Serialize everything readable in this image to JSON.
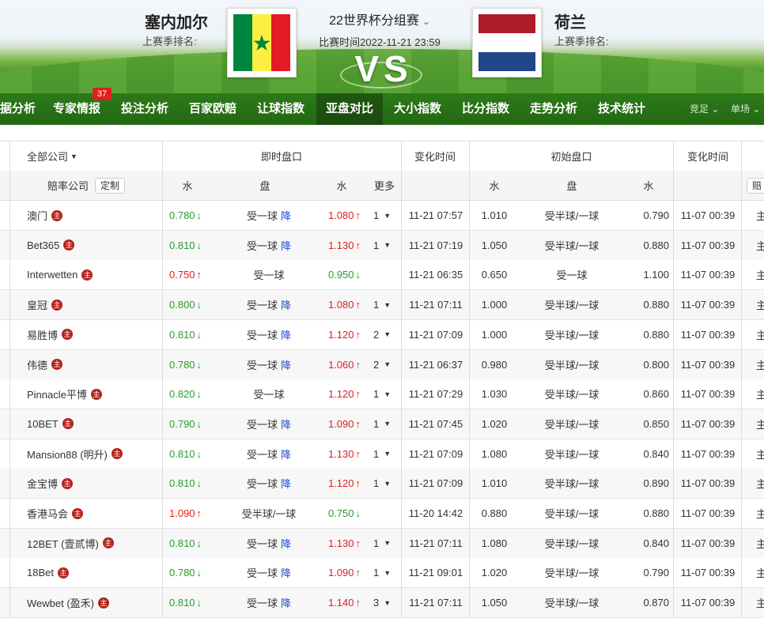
{
  "header": {
    "home_team": "塞内加尔",
    "home_rank_label": "上赛季排名:",
    "away_team": "荷兰",
    "away_rank_label": "上赛季排名:",
    "league": "22世界杯分组赛",
    "match_time": "比赛时间2022-11-21 23:59",
    "vs": "VS"
  },
  "colors": {
    "senegal": [
      "#00853f",
      "#fdef42",
      "#e31b23"
    ],
    "netherlands": [
      "#ae1c28",
      "#ffffff",
      "#21468b"
    ],
    "up": "#e01e1e",
    "down": "#2d9a2d",
    "nav_green": "#2d7a1a"
  },
  "nav": {
    "items": [
      "据分析",
      "专家情报",
      "投注分析",
      "百家欧赔",
      "让球指数",
      "亚盘对比",
      "大小指数",
      "比分指数",
      "走势分析",
      "技术统计"
    ],
    "active_index": 5,
    "badge": "37",
    "dropdown_1": "竞足",
    "dropdown_2": "单场"
  },
  "table": {
    "group_headers": {
      "all_companies": "全部公司",
      "live": "即时盘口",
      "change_time": "变化时间",
      "initial": "初始盘口",
      "change_time2": "变化时间"
    },
    "sub_headers": {
      "company": "赔率公司",
      "custom_btn": "定制",
      "water1": "水",
      "handicap": "盘",
      "water2": "水",
      "more": "更多",
      "init_water1": "水",
      "init_handicap": "盘",
      "init_water2": "水",
      "right_cut": "赔"
    },
    "zhu": "主",
    "jiang": "降",
    "rows": [
      {
        "company": "澳门",
        "w1": "0.780",
        "w1d": "down",
        "hc": "受一球",
        "drop": true,
        "w2": "1.080",
        "w2d": "up",
        "more": "1",
        "time": "11-21 07:57",
        "iw1": "1.010",
        "ihc": "受半球/一球",
        "iw2": "0.790",
        "itime": "11-07 00:39",
        "side": "主"
      },
      {
        "company": "Bet365",
        "w1": "0.810",
        "w1d": "down",
        "hc": "受一球",
        "drop": true,
        "w2": "1.130",
        "w2d": "up",
        "more": "1",
        "time": "11-21 07:19",
        "iw1": "1.050",
        "ihc": "受半球/一球",
        "iw2": "0.880",
        "itime": "11-07 00:39",
        "side": "主"
      },
      {
        "company": "Interwetten",
        "w1": "0.750",
        "w1d": "up",
        "hc": "受一球",
        "drop": false,
        "w2": "0.950",
        "w2d": "down",
        "more": "",
        "time": "11-21 06:35",
        "iw1": "0.650",
        "ihc": "受一球",
        "iw2": "1.100",
        "itime": "11-07 00:39",
        "side": "主"
      },
      {
        "company": "皇冠",
        "w1": "0.800",
        "w1d": "down",
        "hc": "受一球",
        "drop": true,
        "w2": "1.080",
        "w2d": "up",
        "more": "1",
        "time": "11-21 07:11",
        "iw1": "1.000",
        "ihc": "受半球/一球",
        "iw2": "0.880",
        "itime": "11-07 00:39",
        "side": "主"
      },
      {
        "company": "易胜博",
        "w1": "0.810",
        "w1d": "down",
        "hc": "受一球",
        "drop": true,
        "w2": "1.120",
        "w2d": "up",
        "more": "2",
        "time": "11-21 07:09",
        "iw1": "1.000",
        "ihc": "受半球/一球",
        "iw2": "0.880",
        "itime": "11-07 00:39",
        "side": "主"
      },
      {
        "company": "伟德",
        "w1": "0.780",
        "w1d": "down",
        "hc": "受一球",
        "drop": true,
        "w2": "1.060",
        "w2d": "up",
        "more": "2",
        "time": "11-21 06:37",
        "iw1": "0.980",
        "ihc": "受半球/一球",
        "iw2": "0.800",
        "itime": "11-07 00:39",
        "side": "主"
      },
      {
        "company": "Pinnacle平博",
        "w1": "0.820",
        "w1d": "down",
        "hc": "受一球",
        "drop": false,
        "w2": "1.120",
        "w2d": "up",
        "more": "1",
        "time": "11-21 07:29",
        "iw1": "1.030",
        "ihc": "受半球/一球",
        "iw2": "0.860",
        "itime": "11-07 00:39",
        "side": "主"
      },
      {
        "company": "10BET",
        "w1": "0.790",
        "w1d": "down",
        "hc": "受一球",
        "drop": true,
        "w2": "1.090",
        "w2d": "up",
        "more": "1",
        "time": "11-21 07:45",
        "iw1": "1.020",
        "ihc": "受半球/一球",
        "iw2": "0.850",
        "itime": "11-07 00:39",
        "side": "主"
      },
      {
        "company": "Mansion88 (明升)",
        "w1": "0.810",
        "w1d": "down",
        "hc": "受一球",
        "drop": true,
        "w2": "1.130",
        "w2d": "up",
        "more": "1",
        "time": "11-21 07:09",
        "iw1": "1.080",
        "ihc": "受半球/一球",
        "iw2": "0.840",
        "itime": "11-07 00:39",
        "side": "主"
      },
      {
        "company": "金宝博",
        "w1": "0.810",
        "w1d": "down",
        "hc": "受一球",
        "drop": true,
        "w2": "1.120",
        "w2d": "up",
        "more": "1",
        "time": "11-21 07:09",
        "iw1": "1.010",
        "ihc": "受半球/一球",
        "iw2": "0.890",
        "itime": "11-07 00:39",
        "side": "主"
      },
      {
        "company": "香港马会",
        "w1": "1.090",
        "w1d": "up",
        "hc": "受半球/一球",
        "drop": false,
        "w2": "0.750",
        "w2d": "down",
        "more": "",
        "time": "11-20 14:42",
        "iw1": "0.880",
        "ihc": "受半球/一球",
        "iw2": "0.880",
        "itime": "11-07 00:39",
        "side": "主"
      },
      {
        "company": "12BET (壹贰博)",
        "w1": "0.810",
        "w1d": "down",
        "hc": "受一球",
        "drop": true,
        "w2": "1.130",
        "w2d": "up",
        "more": "1",
        "time": "11-21 07:11",
        "iw1": "1.080",
        "ihc": "受半球/一球",
        "iw2": "0.840",
        "itime": "11-07 00:39",
        "side": "主"
      },
      {
        "company": "18Bet",
        "w1": "0.780",
        "w1d": "down",
        "hc": "受一球",
        "drop": true,
        "w2": "1.090",
        "w2d": "up",
        "more": "1",
        "time": "11-21 09:01",
        "iw1": "1.020",
        "ihc": "受半球/一球",
        "iw2": "0.790",
        "itime": "11-07 00:39",
        "side": "主"
      },
      {
        "company": "Wewbet (盈禾)",
        "w1": "0.810",
        "w1d": "down",
        "hc": "受一球",
        "drop": true,
        "w2": "1.140",
        "w2d": "up",
        "more": "3",
        "time": "11-21 07:11",
        "iw1": "1.050",
        "ihc": "受半球/一球",
        "iw2": "0.870",
        "itime": "11-07 00:39",
        "side": "主"
      }
    ]
  }
}
